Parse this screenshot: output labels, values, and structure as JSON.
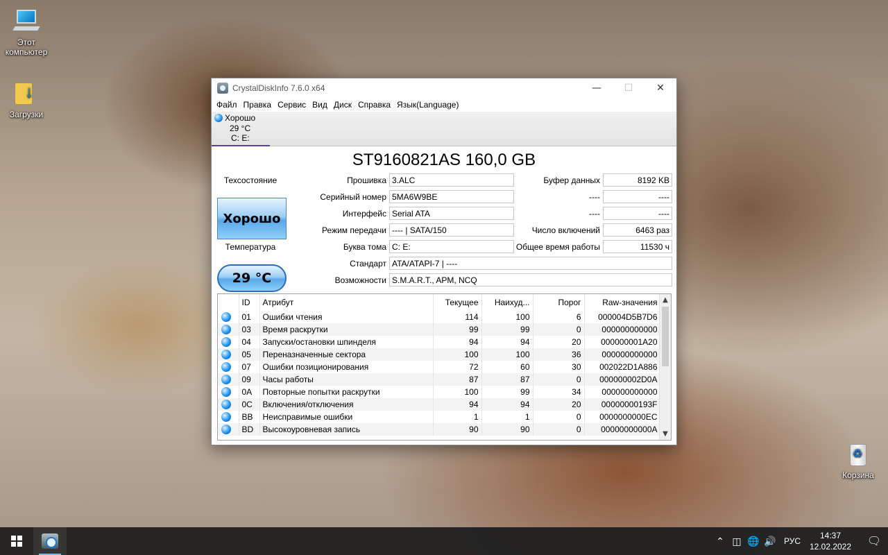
{
  "desktop": {
    "icons": [
      {
        "label": "Этот компьютер"
      },
      {
        "label": "Загрузки"
      },
      {
        "label": "Корзина"
      }
    ]
  },
  "window": {
    "title": "CrystalDiskInfo 7.6.0 x64",
    "menu": [
      "Файл",
      "Правка",
      "Сервис",
      "Вид",
      "Диск",
      "Справка",
      "Язык(Language)"
    ],
    "disk_tab": {
      "status": "Хорошо",
      "temp": "29 °C",
      "letters": "C: E:"
    },
    "model": "ST9160821AS 160,0 GB",
    "health": {
      "label": "Техсостояние",
      "value": "Хорошо"
    },
    "temperature": {
      "label": "Температура",
      "value": "29 °C"
    },
    "fields": {
      "firmware": {
        "label": "Прошивка",
        "value": "3.ALC"
      },
      "serial": {
        "label": "Серийный номер",
        "value": "5MA6W9BE"
      },
      "interface": {
        "label": "Интерфейс",
        "value": "Serial ATA"
      },
      "transfer": {
        "label": "Режим передачи",
        "value": "---- | SATA/150"
      },
      "volume": {
        "label": "Буква тома",
        "value": "C: E:"
      },
      "standard": {
        "label": "Стандарт",
        "value": "ATA/ATAPI-7 | ----"
      },
      "features": {
        "label": "Возможности",
        "value": "S.M.A.R.T., APM, NCQ"
      },
      "buffer": {
        "label": "Буфер данных",
        "value": "8192 KB"
      },
      "blank1": {
        "label": "----",
        "value": "----"
      },
      "blank2": {
        "label": "----",
        "value": "----"
      },
      "power_on_count": {
        "label": "Число включений",
        "value": "6463 раз"
      },
      "power_on_hours": {
        "label": "Общее время работы",
        "value": "11530 ч"
      }
    },
    "smart": {
      "columns": [
        "ID",
        "Атрибут",
        "Текущее",
        "Наихуд...",
        "Порог",
        "Raw-значения"
      ],
      "rows": [
        {
          "id": "01",
          "name": "Ошибки чтения",
          "cur": "114",
          "worst": "100",
          "thr": "6",
          "raw": "000004D5B7D6"
        },
        {
          "id": "03",
          "name": "Время раскрутки",
          "cur": "99",
          "worst": "99",
          "thr": "0",
          "raw": "000000000000"
        },
        {
          "id": "04",
          "name": "Запуски/остановки шпинделя",
          "cur": "94",
          "worst": "94",
          "thr": "20",
          "raw": "000000001A20"
        },
        {
          "id": "05",
          "name": "Переназначенные сектора",
          "cur": "100",
          "worst": "100",
          "thr": "36",
          "raw": "000000000000"
        },
        {
          "id": "07",
          "name": "Ошибки позиционирования",
          "cur": "72",
          "worst": "60",
          "thr": "30",
          "raw": "002022D1A886"
        },
        {
          "id": "09",
          "name": "Часы работы",
          "cur": "87",
          "worst": "87",
          "thr": "0",
          "raw": "000000002D0A"
        },
        {
          "id": "0A",
          "name": "Повторные попытки раскрутки",
          "cur": "100",
          "worst": "99",
          "thr": "34",
          "raw": "000000000000"
        },
        {
          "id": "0C",
          "name": "Включения/отключения",
          "cur": "94",
          "worst": "94",
          "thr": "20",
          "raw": "00000000193F"
        },
        {
          "id": "BB",
          "name": "Неисправимые ошибки",
          "cur": "1",
          "worst": "1",
          "thr": "0",
          "raw": "0000000000EC"
        },
        {
          "id": "BD",
          "name": "Высокоуровневая запись",
          "cur": "90",
          "worst": "90",
          "thr": "0",
          "raw": "00000000000A"
        }
      ]
    }
  },
  "taskbar": {
    "lang": "РУС",
    "time": "14:37",
    "date": "12.02.2022"
  }
}
